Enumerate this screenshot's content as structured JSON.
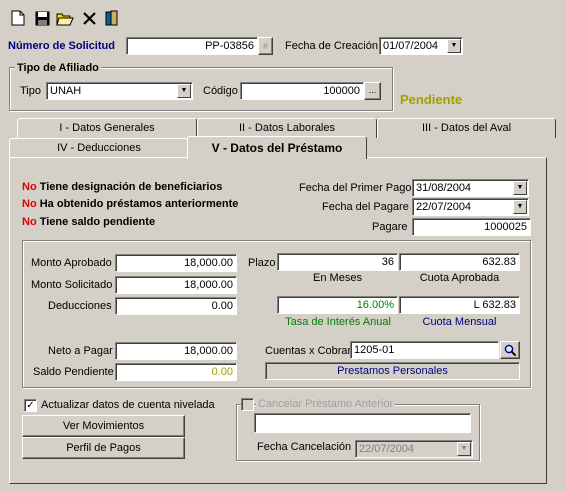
{
  "toolbar": {
    "icons": [
      "new-file-icon",
      "save-icon",
      "open-folder-icon",
      "delete-icon",
      "books-icon"
    ]
  },
  "header": {
    "solicitud_label": "Número de Solicitud",
    "solicitud_value": "PP-03856",
    "fecha_creacion_label": "Fecha de Creación",
    "fecha_creacion_value": "01/07/2004"
  },
  "afiliado": {
    "group_title": "Tipo de Afiliado",
    "tipo_label": "Tipo",
    "tipo_value": "UNAH",
    "codigo_label": "Código",
    "codigo_value": "100000",
    "codigo_button": "...",
    "status": "Pendiente"
  },
  "tabs": [
    {
      "label": "I - Datos Generales"
    },
    {
      "label": "II - Datos Laborales"
    },
    {
      "label": "III - Datos del Aval"
    },
    {
      "label": "IV - Deducciones"
    },
    {
      "label": "V - Datos del Préstamo"
    }
  ],
  "warnings": [
    {
      "prefix": "No",
      "text": "Tiene designación de beneficiarios"
    },
    {
      "prefix": "No",
      "text": "Ha obtenido préstamos anteriormente"
    },
    {
      "prefix": "No",
      "text": "Tiene saldo pendiente"
    }
  ],
  "dates": {
    "primer_pago_label": "Fecha del Primer Pago",
    "primer_pago_value": "31/08/2004",
    "pagare_fecha_label": "Fecha del Pagare",
    "pagare_fecha_value": "22/07/2004",
    "pagare_label": "Pagare",
    "pagare_value": "1000025"
  },
  "loan": {
    "monto_aprobado_label": "Monto Aprobado",
    "monto_aprobado_value": "18,000.00",
    "monto_solicitado_label": "Monto Solicitado",
    "monto_solicitado_value": "18,000.00",
    "deducciones_label": "Deducciones",
    "deducciones_value": "0.00",
    "neto_label": "Neto a Pagar",
    "neto_value": "18,000.00",
    "saldo_label": "Saldo Pendiente",
    "saldo_value": "0.00",
    "plazo_label": "Plazo",
    "plazo_value": "36",
    "plazo_caption": "En Meses",
    "cuota_aprobada_value": "632.83",
    "cuota_aprobada_caption": "Cuota Aprobada",
    "tasa_value": "16.00%",
    "tasa_caption": "Tasa de Interés Anual",
    "cuota_mensual_value": "L 632.83",
    "cuota_mensual_caption": "Cuota Mensual",
    "cuentas_label": "Cuentas x Cobrar",
    "cuentas_value": "1205-01",
    "cuentas_desc": "Prestamos Personales"
  },
  "bottom": {
    "actualizar_label": "Actualizar datos de cuenta nivelada",
    "actualizar_checked": "✓",
    "ver_movimientos": "Ver Movimientos",
    "perfil_pagos": "Perfil de Pagos",
    "cancelar_label": "Cancelar Préstamo Anterior",
    "fecha_cancelacion_label": "Fecha Cancelación",
    "fecha_cancelacion_value": "22/07/2004"
  },
  "colors": {
    "face": "#d4d0c8",
    "label_blue": "#000080",
    "status_olive": "#a0a000",
    "warning_red": "#e00000",
    "caption_green": "#008000",
    "caption_navy": "#000080"
  }
}
